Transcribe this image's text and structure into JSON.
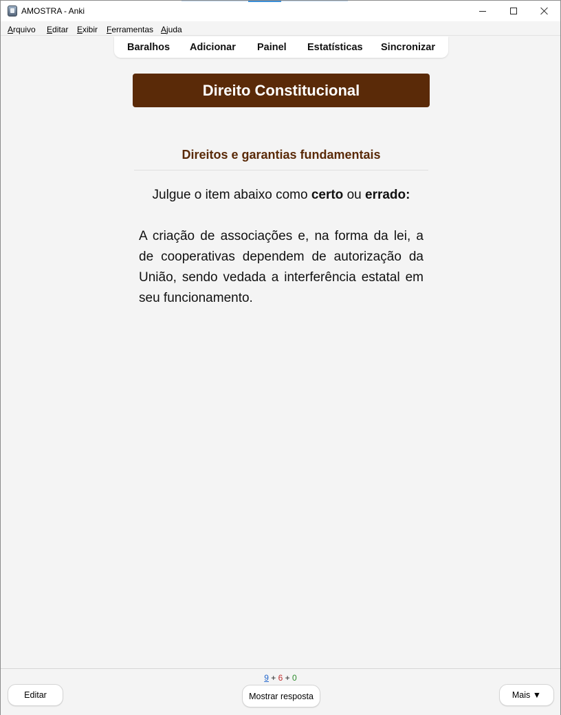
{
  "window": {
    "title": "AMOSTRA - Anki"
  },
  "menu": {
    "items": [
      {
        "first": "A",
        "rest": "rquivo"
      },
      {
        "first": "E",
        "rest": "ditar"
      },
      {
        "first": "E",
        "rest": "xibir"
      },
      {
        "first": "F",
        "rest": "erramentas"
      },
      {
        "first": "A",
        "rest": "juda"
      }
    ]
  },
  "nav": {
    "decks": "Baralhos",
    "add": "Adicionar",
    "browse": "Painel",
    "stats": "Estatísticas",
    "sync": "Sincronizar"
  },
  "card": {
    "deck_title": "Direito Constitucional",
    "topic": "Direitos e garantias fundamentais",
    "instruction_prefix": "Julgue o item abaixo como ",
    "instruction_certo": "certo",
    "instruction_middle": " ou ",
    "instruction_errado": "errado:",
    "question": "A criação de associações e, na forma da lei, a de cooperativas dependem de autorização da União, sendo vedada a interferência estatal em seu funcionamento."
  },
  "counts": {
    "new": "9",
    "plus1": " + ",
    "learning": "6",
    "plus2": " + ",
    "review": "0"
  },
  "bottom": {
    "edit_label": "Editar",
    "show_answer_label": "Mostrar resposta",
    "more_label": "Mais ▼"
  },
  "colors": {
    "deck_banner": "#5a2a08",
    "topic": "#5a2a08",
    "count_new": "#2266cc",
    "count_learning": "#c03030",
    "count_review": "#2a8a2a"
  }
}
